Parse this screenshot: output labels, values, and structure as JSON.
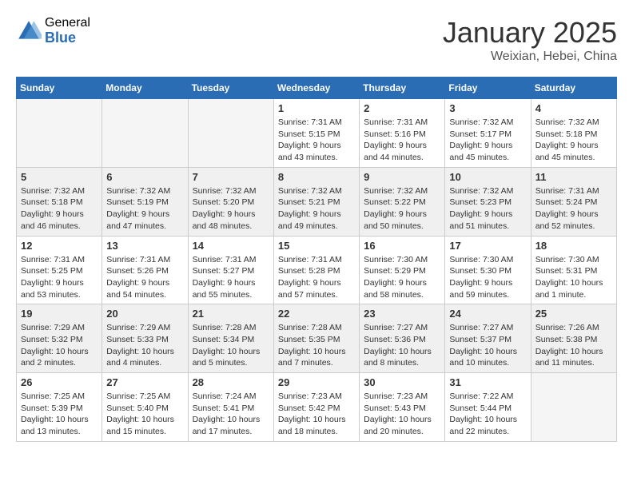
{
  "logo": {
    "general": "General",
    "blue": "Blue"
  },
  "title": "January 2025",
  "subtitle": "Weixian, Hebei, China",
  "days_of_week": [
    "Sunday",
    "Monday",
    "Tuesday",
    "Wednesday",
    "Thursday",
    "Friday",
    "Saturday"
  ],
  "weeks": [
    {
      "shaded": false,
      "days": [
        {
          "num": "",
          "info": ""
        },
        {
          "num": "",
          "info": ""
        },
        {
          "num": "",
          "info": ""
        },
        {
          "num": "1",
          "info": "Sunrise: 7:31 AM\nSunset: 5:15 PM\nDaylight: 9 hours\nand 43 minutes."
        },
        {
          "num": "2",
          "info": "Sunrise: 7:31 AM\nSunset: 5:16 PM\nDaylight: 9 hours\nand 44 minutes."
        },
        {
          "num": "3",
          "info": "Sunrise: 7:32 AM\nSunset: 5:17 PM\nDaylight: 9 hours\nand 45 minutes."
        },
        {
          "num": "4",
          "info": "Sunrise: 7:32 AM\nSunset: 5:18 PM\nDaylight: 9 hours\nand 45 minutes."
        }
      ]
    },
    {
      "shaded": true,
      "days": [
        {
          "num": "5",
          "info": "Sunrise: 7:32 AM\nSunset: 5:18 PM\nDaylight: 9 hours\nand 46 minutes."
        },
        {
          "num": "6",
          "info": "Sunrise: 7:32 AM\nSunset: 5:19 PM\nDaylight: 9 hours\nand 47 minutes."
        },
        {
          "num": "7",
          "info": "Sunrise: 7:32 AM\nSunset: 5:20 PM\nDaylight: 9 hours\nand 48 minutes."
        },
        {
          "num": "8",
          "info": "Sunrise: 7:32 AM\nSunset: 5:21 PM\nDaylight: 9 hours\nand 49 minutes."
        },
        {
          "num": "9",
          "info": "Sunrise: 7:32 AM\nSunset: 5:22 PM\nDaylight: 9 hours\nand 50 minutes."
        },
        {
          "num": "10",
          "info": "Sunrise: 7:32 AM\nSunset: 5:23 PM\nDaylight: 9 hours\nand 51 minutes."
        },
        {
          "num": "11",
          "info": "Sunrise: 7:31 AM\nSunset: 5:24 PM\nDaylight: 9 hours\nand 52 minutes."
        }
      ]
    },
    {
      "shaded": false,
      "days": [
        {
          "num": "12",
          "info": "Sunrise: 7:31 AM\nSunset: 5:25 PM\nDaylight: 9 hours\nand 53 minutes."
        },
        {
          "num": "13",
          "info": "Sunrise: 7:31 AM\nSunset: 5:26 PM\nDaylight: 9 hours\nand 54 minutes."
        },
        {
          "num": "14",
          "info": "Sunrise: 7:31 AM\nSunset: 5:27 PM\nDaylight: 9 hours\nand 55 minutes."
        },
        {
          "num": "15",
          "info": "Sunrise: 7:31 AM\nSunset: 5:28 PM\nDaylight: 9 hours\nand 57 minutes."
        },
        {
          "num": "16",
          "info": "Sunrise: 7:30 AM\nSunset: 5:29 PM\nDaylight: 9 hours\nand 58 minutes."
        },
        {
          "num": "17",
          "info": "Sunrise: 7:30 AM\nSunset: 5:30 PM\nDaylight: 9 hours\nand 59 minutes."
        },
        {
          "num": "18",
          "info": "Sunrise: 7:30 AM\nSunset: 5:31 PM\nDaylight: 10 hours\nand 1 minute."
        }
      ]
    },
    {
      "shaded": true,
      "days": [
        {
          "num": "19",
          "info": "Sunrise: 7:29 AM\nSunset: 5:32 PM\nDaylight: 10 hours\nand 2 minutes."
        },
        {
          "num": "20",
          "info": "Sunrise: 7:29 AM\nSunset: 5:33 PM\nDaylight: 10 hours\nand 4 minutes."
        },
        {
          "num": "21",
          "info": "Sunrise: 7:28 AM\nSunset: 5:34 PM\nDaylight: 10 hours\nand 5 minutes."
        },
        {
          "num": "22",
          "info": "Sunrise: 7:28 AM\nSunset: 5:35 PM\nDaylight: 10 hours\nand 7 minutes."
        },
        {
          "num": "23",
          "info": "Sunrise: 7:27 AM\nSunset: 5:36 PM\nDaylight: 10 hours\nand 8 minutes."
        },
        {
          "num": "24",
          "info": "Sunrise: 7:27 AM\nSunset: 5:37 PM\nDaylight: 10 hours\nand 10 minutes."
        },
        {
          "num": "25",
          "info": "Sunrise: 7:26 AM\nSunset: 5:38 PM\nDaylight: 10 hours\nand 11 minutes."
        }
      ]
    },
    {
      "shaded": false,
      "days": [
        {
          "num": "26",
          "info": "Sunrise: 7:25 AM\nSunset: 5:39 PM\nDaylight: 10 hours\nand 13 minutes."
        },
        {
          "num": "27",
          "info": "Sunrise: 7:25 AM\nSunset: 5:40 PM\nDaylight: 10 hours\nand 15 minutes."
        },
        {
          "num": "28",
          "info": "Sunrise: 7:24 AM\nSunset: 5:41 PM\nDaylight: 10 hours\nand 17 minutes."
        },
        {
          "num": "29",
          "info": "Sunrise: 7:23 AM\nSunset: 5:42 PM\nDaylight: 10 hours\nand 18 minutes."
        },
        {
          "num": "30",
          "info": "Sunrise: 7:23 AM\nSunset: 5:43 PM\nDaylight: 10 hours\nand 20 minutes."
        },
        {
          "num": "31",
          "info": "Sunrise: 7:22 AM\nSunset: 5:44 PM\nDaylight: 10 hours\nand 22 minutes."
        },
        {
          "num": "",
          "info": ""
        }
      ]
    }
  ]
}
